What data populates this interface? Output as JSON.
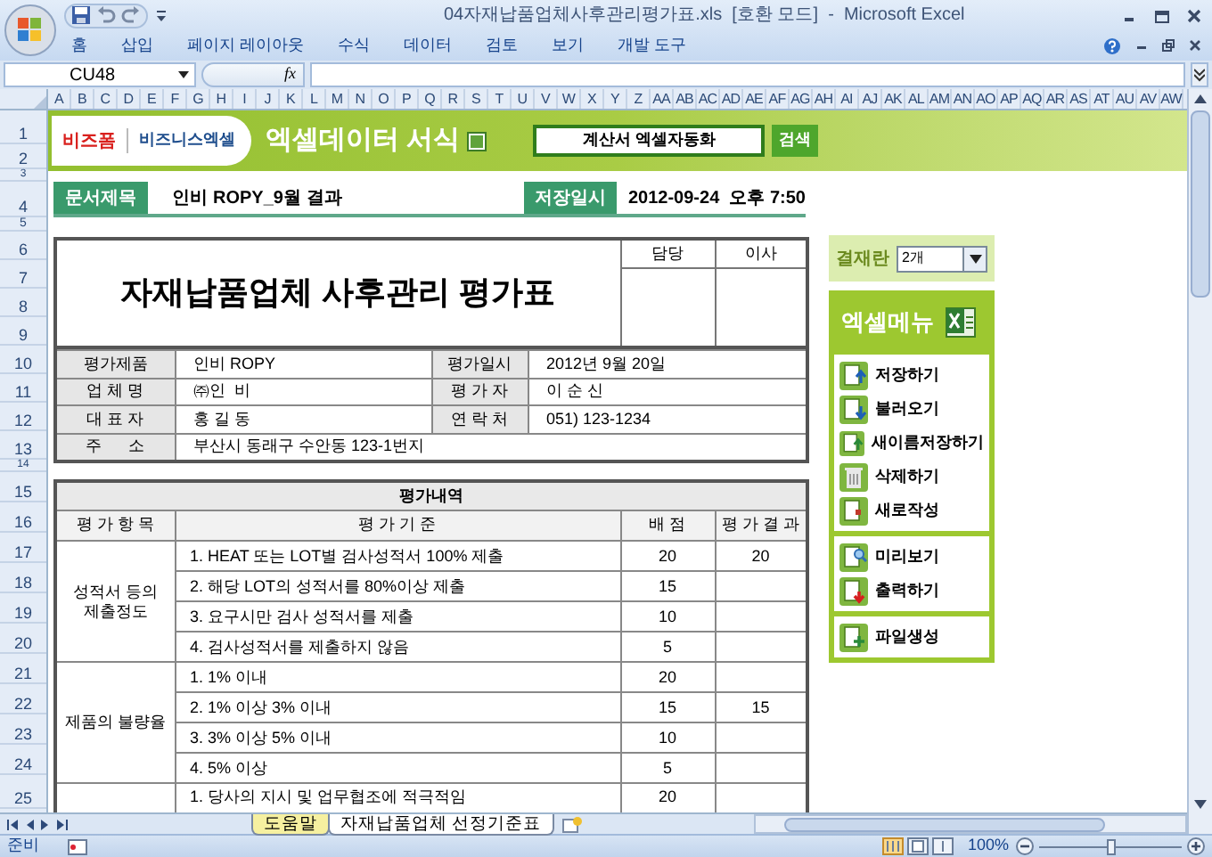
{
  "window": {
    "title": "04자재납품업체사후관리평가표.xls  [호환 모드]  -  Microsoft Excel"
  },
  "ribbon_tabs": [
    "홈",
    "삽입",
    "페이지 레이아웃",
    "수식",
    "데이터",
    "검토",
    "보기",
    "개발 도구"
  ],
  "formula_bar": {
    "name_box": "CU48",
    "function_label": "fx"
  },
  "column_headers": [
    "A",
    "B",
    "C",
    "D",
    "E",
    "F",
    "G",
    "H",
    "I",
    "J",
    "K",
    "L",
    "M",
    "N",
    "O",
    "P",
    "Q",
    "R",
    "S",
    "T",
    "U",
    "V",
    "W",
    "X",
    "Y",
    "Z",
    "AA",
    "AB",
    "AC",
    "AD",
    "AE",
    "AF",
    "AG",
    "AH",
    "AI",
    "AJ",
    "AK",
    "AL",
    "AM",
    "AN",
    "AO",
    "AP",
    "AQ",
    "AR",
    "AS",
    "AT",
    "AU",
    "AV",
    "AW"
  ],
  "row_headers": [
    "1",
    "2",
    "3",
    "4",
    "5",
    "6",
    "7",
    "8",
    "9",
    "10",
    "11",
    "12",
    "13",
    "14",
    "15",
    "16",
    "17",
    "18",
    "19",
    "20",
    "21",
    "22",
    "23",
    "24",
    "25"
  ],
  "banner": {
    "brand": "비즈폼",
    "brand_sub": "비즈니스엑셀",
    "title": "엑셀데이터 서식",
    "search_value": "계산서 엑셀자동화",
    "search_button": "검색"
  },
  "document": {
    "title_label": "문서제목",
    "title_value": "인비 ROPY_9월 결과",
    "saved_label": "저장일시",
    "saved_value": "2012-09-24  오후 7:50"
  },
  "form": {
    "title": "자재납품업체 사후관리 평가표",
    "approvals": [
      "담당",
      "이사"
    ],
    "rows": [
      [
        {
          "label": "평가제품",
          "value": "인비 ROPY"
        },
        {
          "label": "평가일시",
          "value": "2012년 9월 20일"
        }
      ],
      [
        {
          "label": "업 체 명",
          "value": "㈜인  비"
        },
        {
          "label": "평 가 자",
          "value": "이 순 신"
        }
      ],
      [
        {
          "label": "대 표 자",
          "value": "홍 길 동"
        },
        {
          "label": "연 락 처",
          "value": "051) 123-1234"
        }
      ],
      [
        {
          "label": "주      소",
          "value": "부산시 동래구 수안동 123-1번지"
        }
      ]
    ]
  },
  "evaluation": {
    "title": "평가내역",
    "columns": [
      "평 가 항 목",
      "평 가 기 준",
      "배 점",
      "평 가 결 과"
    ],
    "groups": [
      {
        "category": "성적서 등의\n제출정도",
        "items": [
          {
            "criterion": "1. HEAT 또는 LOT별 검사성적서 100% 제출",
            "score": "20",
            "result": "20"
          },
          {
            "criterion": "2. 해당 LOT의 성적서를 80%이상 제출",
            "score": "15"
          },
          {
            "criterion": "3. 요구시만 검사 성적서를 제출",
            "score": "10"
          },
          {
            "criterion": "4. 검사성적서를 제출하지 않음",
            "score": "5"
          }
        ]
      },
      {
        "category": "제품의 불량율",
        "items": [
          {
            "criterion": "1. 1% 이내",
            "score": "20"
          },
          {
            "criterion": "2. 1% 이상 3% 이내",
            "score": "15",
            "result": "15"
          },
          {
            "criterion": "3. 3% 이상 5% 이내",
            "score": "10"
          },
          {
            "criterion": "4. 5% 이상",
            "score": "5"
          }
        ]
      },
      {
        "items": [
          {
            "criterion": "1. 당사의 지시 및 업무협조에 적극적임",
            "score": "20"
          }
        ]
      }
    ]
  },
  "side_panel": {
    "approval_label": "결재란",
    "approval_select": "2개",
    "menu_title": "엑셀메뉴",
    "menu_groups": [
      [
        {
          "label": "저장하기",
          "kind": "save"
        },
        {
          "label": "불러오기",
          "kind": "load"
        },
        {
          "label": "새이름저장하기",
          "kind": "saveas"
        },
        {
          "label": "삭제하기",
          "kind": "delete"
        },
        {
          "label": "새로작성",
          "kind": "new"
        }
      ],
      [
        {
          "label": "미리보기",
          "kind": "preview"
        },
        {
          "label": "출력하기",
          "kind": "print"
        }
      ],
      [
        {
          "label": "파일생성",
          "kind": "create"
        }
      ]
    ]
  },
  "sheet_tabs": [
    {
      "label": "도움말",
      "color": "#f6f0a0"
    },
    {
      "label": "자재납품업체 선정기준표",
      "color": "#ffffff"
    }
  ],
  "status_bar": {
    "text": "준비",
    "zoom": "100%",
    "zoom_slider": {
      "level": 0.5
    }
  }
}
